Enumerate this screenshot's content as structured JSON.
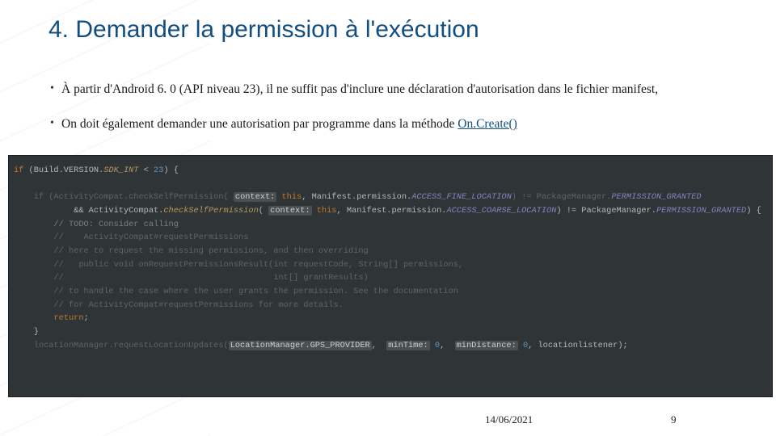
{
  "title": "4. Demander la permission à l'exécution",
  "bullets": [
    "À partir d'Android 6. 0 (API niveau 23), il ne suffit pas d'inclure une déclaration d'autorisation dans le fichier manifest,",
    "On doit également demander une autorisation par programme dans la méthode "
  ],
  "link_text": "On.Create()",
  "code": {
    "l1a": "if",
    "l1b": " (Build.VERSION.",
    "l1c": "SDK_INT",
    "l1d": " < ",
    "l1e": "23",
    "l1f": ") {",
    "l2": "",
    "l3a": "    if (ActivityCompat.checkSelfPermission( ",
    "l3b": "context:",
    "l3c": " this",
    "l3d": ", Manifest.permission.",
    "l3e": "ACCESS_FINE_LOCATION",
    "l3f": ") != PackageManager.",
    "l3g": "PERMISSION_GRANTED",
    "l4a": "            && ActivityCompat.",
    "l4b": "checkSelfPermission",
    "l4c": "( ",
    "l4d": "context:",
    "l4e": " this",
    "l4f": ", Manifest.permission.",
    "l4g": "ACCESS_COARSE_LOCATION",
    "l4h": ") != PackageManager.",
    "l4i": "PERMISSION_GRANTED",
    "l4j": ") {",
    "l5": "        // TODO: Consider calling",
    "l6": "        //    ActivityCompat#requestPermissions",
    "l7": "        // here to request the missing permissions, and then overriding",
    "l8": "        //   public void onRequestPermissionsResult(int requestCode, String[] permissions,",
    "l9": "        //                                          int[] grantResults)",
    "l10": "        // to handle the case where the user grants the permission. See the documentation",
    "l11": "        // for ActivityCompat#requestPermissions for more details.",
    "l12a": "        ",
    "l12b": "return",
    "l12c": ";",
    "l13": "    }",
    "l14a": "    locationManager.requestLocationUpdates(",
    "l14b": "LocationManager.GPS_PROVIDER",
    "l14c": ",  ",
    "l14d": "minTime:",
    "l14e": " 0",
    "l14f": ",  ",
    "l14g": "minDistance:",
    "l14h": " 0",
    "l14i": ", locationlistener);"
  },
  "date": "14/06/2021",
  "page": "9"
}
